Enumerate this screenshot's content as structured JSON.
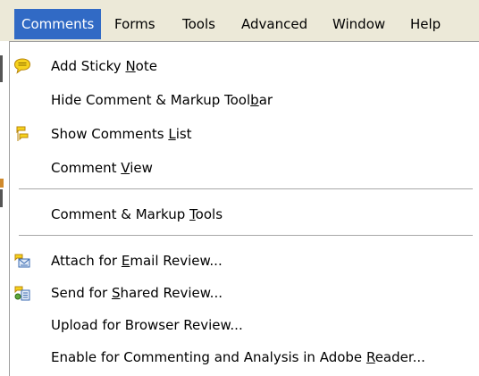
{
  "menubar": {
    "items": [
      {
        "label": "Comments",
        "active": true
      },
      {
        "label": "Forms"
      },
      {
        "label": "Tools"
      },
      {
        "label": "Advanced"
      },
      {
        "label": "Window"
      },
      {
        "label": "Help"
      }
    ]
  },
  "dropdown": {
    "items": [
      {
        "pre": "Add Sticky ",
        "key": "N",
        "post": "ote",
        "icon": "sticky-note-icon"
      },
      {
        "pre": "Hide Comment & Markup Tool",
        "key": "b",
        "post": "ar"
      },
      {
        "pre": "Show Comments ",
        "key": "L",
        "post": "ist",
        "icon": "comments-list-icon"
      },
      {
        "pre": "Comment ",
        "key": "V",
        "post": "iew"
      },
      {
        "pre": "Comment & Markup ",
        "key": "T",
        "post": "ools"
      },
      {
        "pre": "Attach for ",
        "key": "E",
        "post": "mail Review...",
        "icon": "email-review-icon"
      },
      {
        "pre": "Send for ",
        "key": "S",
        "post": "hared Review...",
        "icon": "shared-review-icon"
      },
      {
        "pre": "Upload for Browser Review...",
        "key": "",
        "post": ""
      },
      {
        "pre": "Enable for Commenting and Analysis in Adobe ",
        "key": "R",
        "post": "eader..."
      }
    ]
  },
  "colors": {
    "menubar_bg": "#ece9d8",
    "highlight": "#316ac5",
    "separator": "#a8a8a8"
  }
}
